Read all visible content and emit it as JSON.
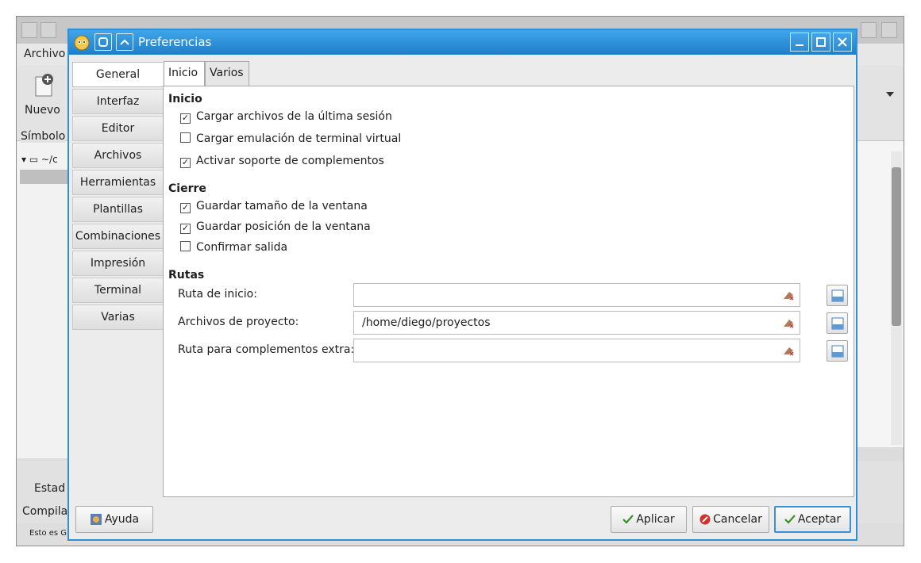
{
  "background_window": {
    "menu_first": "Archivo",
    "toolbar_new": "Nuevo",
    "sidebar_tab": "Símbolo",
    "tree_item": "~/c",
    "bottom_tab1": "Estad",
    "bottom_tab2": "Compila",
    "status_text": "Esto es G"
  },
  "dialog": {
    "title": "Preferencias",
    "nav_items": [
      "General",
      "Interfaz",
      "Editor",
      "Archivos",
      "Herramientas",
      "Plantillas",
      "Combinaciones",
      "Impresión",
      "Terminal",
      "Varias"
    ],
    "active_nav": "General",
    "tabs": [
      "Inicio",
      "Varios"
    ],
    "active_tab": "Inicio",
    "inicio": {
      "header": "Inicio",
      "options": [
        {
          "label": "Cargar archivos de la última sesión",
          "checked": true
        },
        {
          "label": "Cargar emulación de terminal virtual",
          "checked": false
        },
        {
          "label": "Activar soporte de complementos",
          "checked": true
        }
      ]
    },
    "cierre": {
      "header": "Cierre",
      "options": [
        {
          "label": "Guardar tamaño de la ventana",
          "checked": true
        },
        {
          "label": "Guardar posición de la ventana",
          "checked": true
        },
        {
          "label": "Confirmar salida",
          "checked": false
        }
      ]
    },
    "rutas": {
      "header": "Rutas",
      "fields": [
        {
          "label": "Ruta de inicio:",
          "value": ""
        },
        {
          "label": "Archivos de proyecto:",
          "value": "/home/diego/proyectos"
        },
        {
          "label": "Ruta para complementos extra:",
          "value": ""
        }
      ]
    },
    "buttons": {
      "help": "Ayuda",
      "apply": "Aplicar",
      "cancel": "Cancelar",
      "accept": "Aceptar"
    }
  },
  "colors": {
    "titlebar": "#2f8fd6",
    "accent": "#3d8fd1",
    "cancel_icon": "#d0312d",
    "check_icon": "#3a8f2a"
  }
}
